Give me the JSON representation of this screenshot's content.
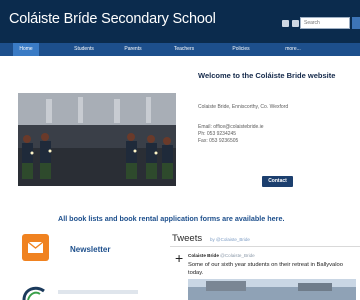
{
  "header": {
    "site_title": "Coláiste Bríde Secondary School",
    "search_placeholder": "Search"
  },
  "nav": {
    "items": [
      "Home",
      "Students",
      "Parents",
      "Teachers",
      "Policies",
      "more..."
    ],
    "active": "Home"
  },
  "welcome": {
    "heading": "Welcome to the Coláiste Bride website",
    "address": "Colaiste Bride, Enniscorthy, Co. Wexford",
    "email": "Email: office@colaistebride.ie",
    "phone": "Ph: 053 9234245",
    "fax": "Fax: 053 9236505",
    "contact_button": "Contact"
  },
  "book_notice": "All book lists and book rental application forms are available here.",
  "newsletter": {
    "label": "Newsletter"
  },
  "tweets": {
    "title": "Tweets",
    "by": "by @Colaiste_Bride",
    "author_name": "Colaiste Bride",
    "author_handle": "@Colaiste_Bride",
    "text": "Some of our sixth year students on their retreat in Ballyvaloo today."
  },
  "colors": {
    "header_bg": "#0b2b4d",
    "nav_bg": "#1d4f8c",
    "nav_active": "#3a7bc5",
    "accent_text": "#1d4f8c",
    "contact_button": "#1c3f6e",
    "newsletter_icon": "#f08220"
  }
}
